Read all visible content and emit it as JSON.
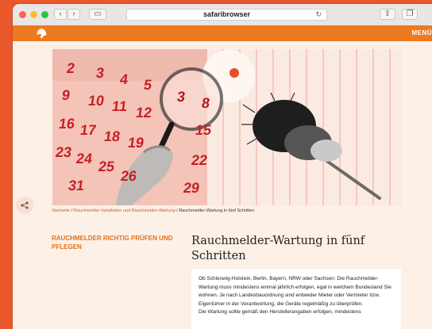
{
  "browser": {
    "address_text": "safaribrowser",
    "back_glyph": "‹",
    "forward_glyph": "›",
    "sidebar_glyph": "▭",
    "reload_glyph": "↻",
    "share_glyph": "⇪",
    "tabs_glyph": "❐"
  },
  "site": {
    "menu_label": "MENÜ",
    "accent_color": "#ee7a1f",
    "background_color": "#fdf0e6"
  },
  "hero": {
    "calendar_numbers": [
      "2",
      "3",
      "4",
      "5",
      "9",
      "10",
      "11",
      "12",
      "16",
      "17",
      "18",
      "19",
      "23",
      "24",
      "25",
      "26",
      "31",
      "3",
      "8",
      "15",
      "22",
      "29"
    ],
    "dot_color": "#e2502e"
  },
  "share_icon_glyph": "<",
  "breadcrumb": {
    "items": [
      "Startseite",
      "Rauchmelder Installation und Rauchmelder-Wartung",
      "Rauchmelder-Wartung in fünf Schritten"
    ],
    "separator": " / "
  },
  "sidebar_heading": "RAUCHMELDER RICHTIG PRÜFEN UND PFLEGEN",
  "article": {
    "title": "Rauchmelder-Wartung in fünf Schritten",
    "paragraph": "Ob Schleswig-Holstein, Berlin, Bayern, NRW oder Sachsen: Die Rauchmelder-Wartung muss mindestens einmal jährlich erfolgen, egal in welchem Bundesland Sie wohnen. Je nach Landesbauordnung sind entweder Mieter oder Vermieter bzw. Eigentümer in der Verantwortung, die Geräte regelmäßig zu überprüfen.",
    "paragraph_cutoff": "Die Wartung sollte gemäß den Herstellerangaben erfolgen, mindestens"
  }
}
